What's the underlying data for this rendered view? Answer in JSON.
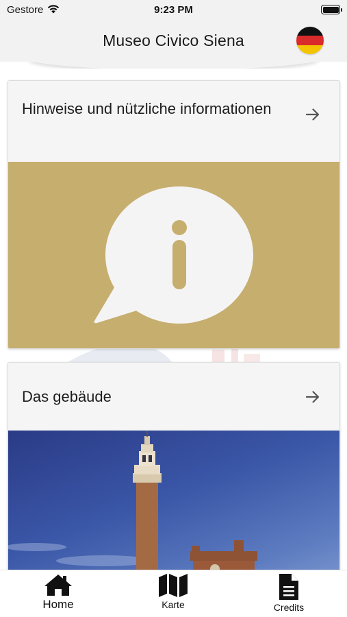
{
  "status_bar": {
    "carrier": "Gestore",
    "time": "9:23 PM"
  },
  "header": {
    "title": "Museo Civico Siena",
    "language_flag": {
      "icon": "german-flag-icon",
      "colors": [
        "#111111",
        "#d92b2b",
        "#f5c400"
      ]
    }
  },
  "cards": [
    {
      "title": "Hinweise und nützliche informationen",
      "arrow_icon": "arrow-right-icon",
      "image_icon": "info-speech-bubble-icon",
      "image_bg": "#c6ae6f"
    },
    {
      "title": "Das gebäude",
      "arrow_icon": "arrow-right-icon",
      "image_desc_icon": "palazzo-pubblico-tower-photo"
    }
  ],
  "tabbar": {
    "tabs": [
      {
        "label": "Home",
        "icon": "home-icon",
        "active": true
      },
      {
        "label": "Karte",
        "icon": "map-icon",
        "active": false
      },
      {
        "label": "Credits",
        "icon": "document-icon",
        "active": false
      }
    ]
  }
}
